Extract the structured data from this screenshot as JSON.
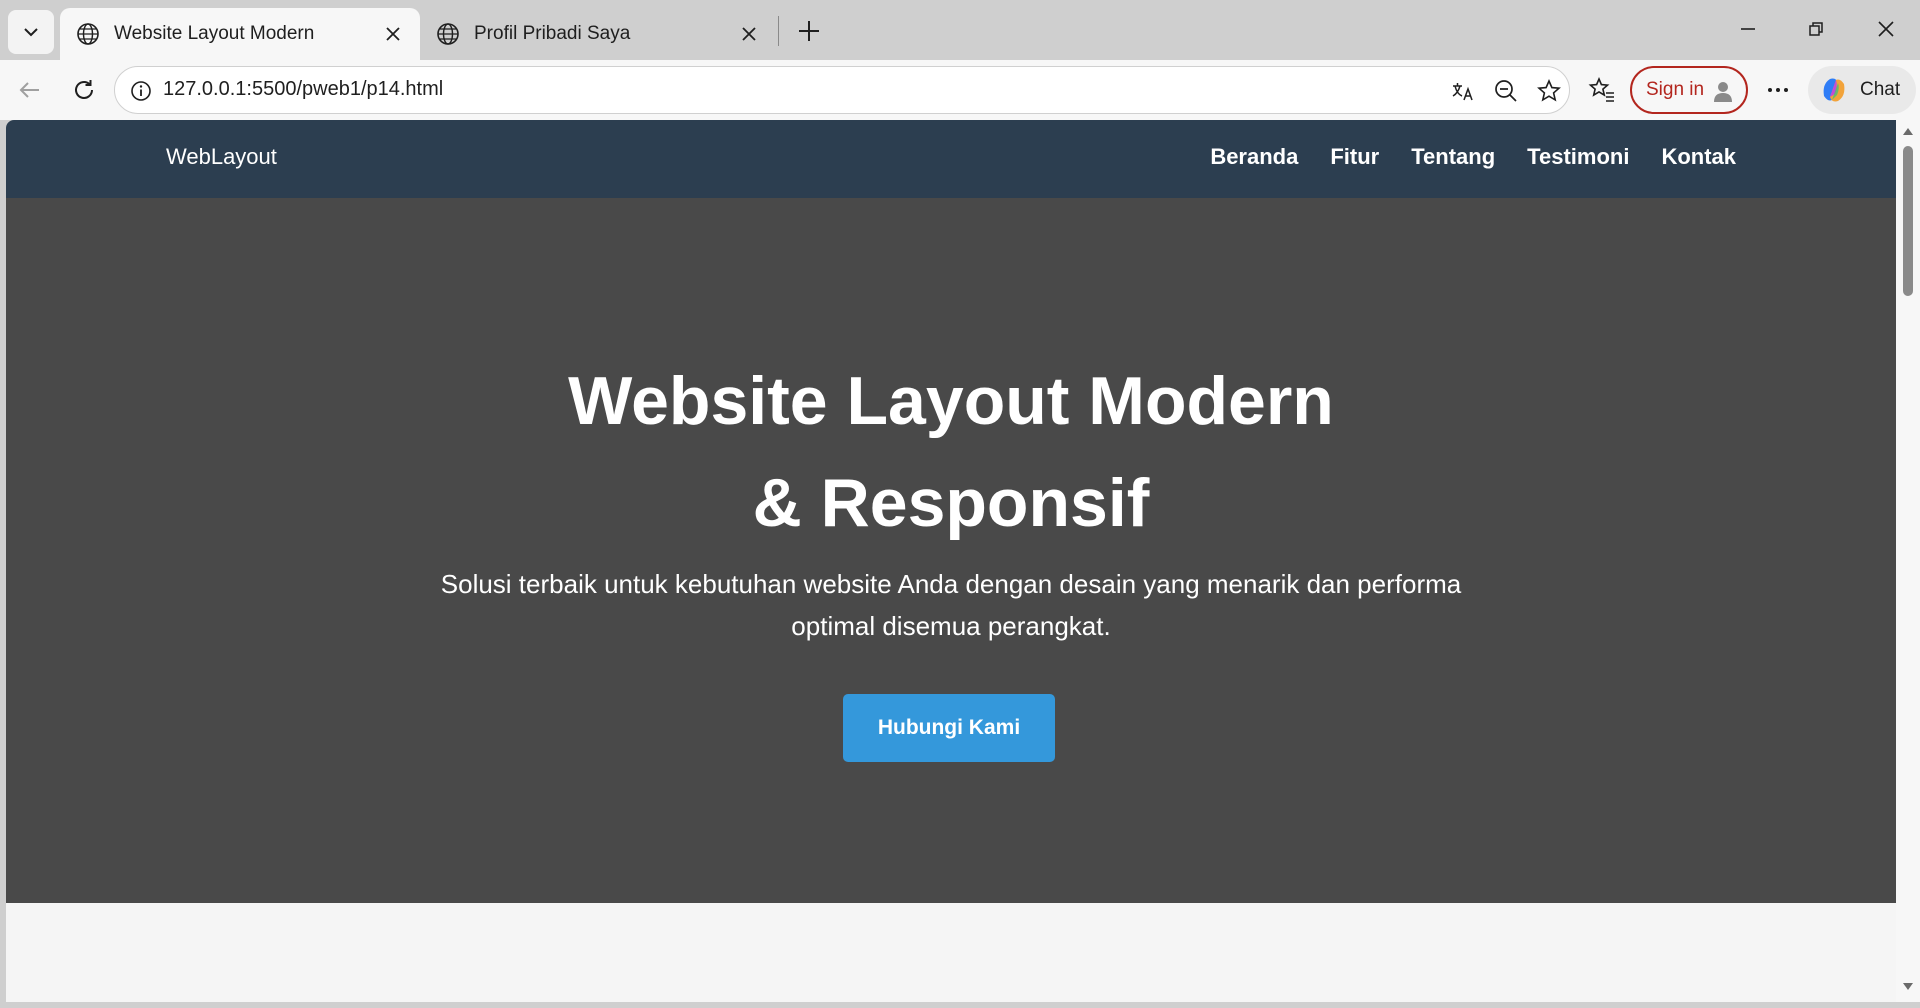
{
  "tabs": [
    {
      "title": "Website Layout Modern",
      "active": true,
      "icon": "globe-icon"
    },
    {
      "title": "Profil Pribadi Saya",
      "active": false,
      "icon": "globe-icon"
    }
  ],
  "toolbar": {
    "url": "127.0.0.1:5500/pweb1/p14.html",
    "signin_label": "Sign in",
    "chat_label": "Chat"
  },
  "page": {
    "brand": "WebLayout",
    "nav": [
      "Beranda",
      "Fitur",
      "Tentang",
      "Testimoni",
      "Kontak"
    ],
    "hero_title": "Website Layout Modern & Responsif",
    "hero_subtitle": "Solusi terbaik untuk kebutuhan website Anda dengan desain yang menarik dan performa optimal disemua perangkat.",
    "cta_label": "Hubungi Kami"
  },
  "colors": {
    "nav_bg": "#2c3e50",
    "hero_bg": "#494949",
    "cta_bg": "#3498db",
    "signin_accent": "#b3261e"
  }
}
